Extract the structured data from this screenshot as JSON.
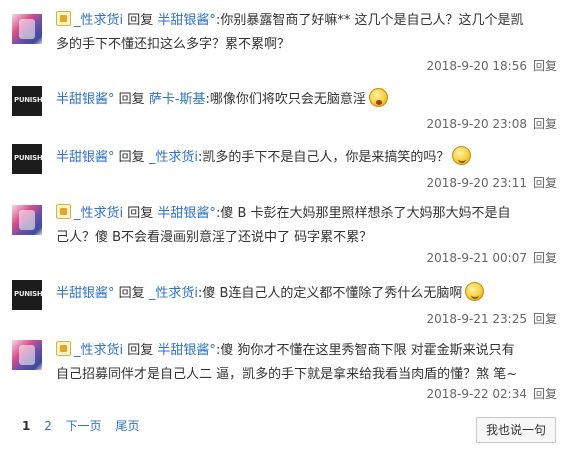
{
  "reply_word": "回复",
  "replies": [
    {
      "avatar": "pink-character-avatar",
      "vip": true,
      "author": "_性求货i",
      "target": "半甜银酱°",
      "lines": [
        ":你别暴露智商了好嘛** 这几个是自己人？这几个是凯",
        "多的手下不懂还扣这么多字？累不累啊？"
      ],
      "emoji": null,
      "time": "2018-9-20 18:56",
      "reply_label": "回复"
    },
    {
      "avatar": "dark-logo-avatar",
      "avatar_text": "PUNISHER",
      "vip": false,
      "author": "半甜银酱°",
      "target": "萨卡-斯基",
      "lines": [
        ":哪像你们将吹只会无脑意淫"
      ],
      "emoji": "shocked-face-emoji",
      "time": "2018-9-20 23:08",
      "reply_label": "回复"
    },
    {
      "avatar": "dark-logo-avatar",
      "avatar_text": "PUNISHER",
      "vip": false,
      "author": "半甜银酱°",
      "target": "_性求货i",
      "lines": [
        ":凯多的手下不是自己人，你是来搞笑的吗？"
      ],
      "emoji": "smile-face-emoji",
      "time": "2018-9-20 23:11",
      "reply_label": "回复"
    },
    {
      "avatar": "pink-character-avatar",
      "vip": true,
      "author": "_性求货i",
      "target": "半甜银酱°",
      "lines": [
        ":傻 B 卡彭在大妈那里照样想杀了大妈那大妈不是自",
        "己人？傻 B不会看漫画别意淫了还说中了 码字累不累？"
      ],
      "emoji": null,
      "time": "2018-9-21 00:07",
      "reply_label": "回复"
    },
    {
      "avatar": "dark-logo-avatar",
      "avatar_text": "PUNISHER",
      "vip": false,
      "author": "半甜银酱°",
      "target": "_性求货i",
      "lines": [
        ":傻 B连自己人的定义都不懂除了秀什么无脑啊"
      ],
      "emoji": "smile-face-emoji",
      "time": "2018-9-21 23:25",
      "reply_label": "回复"
    },
    {
      "avatar": "pink-character-avatar",
      "vip": true,
      "author": "_性求货i",
      "target": "半甜银酱°",
      "lines": [
        ":傻 狗你才不懂在这里秀智商下限 对霍金斯来说只有",
        "自己招募同伴才是自己人二 逼，凯多的手下就是拿来给我看当肉盾的懂？煞 笔~"
      ],
      "emoji": null,
      "time": "2018-9-22 02:34",
      "reply_label": "回复"
    }
  ],
  "pager": {
    "current": "1",
    "page2": "2",
    "next": "下一页",
    "last": "尾页"
  },
  "say_button": "我也说一句"
}
